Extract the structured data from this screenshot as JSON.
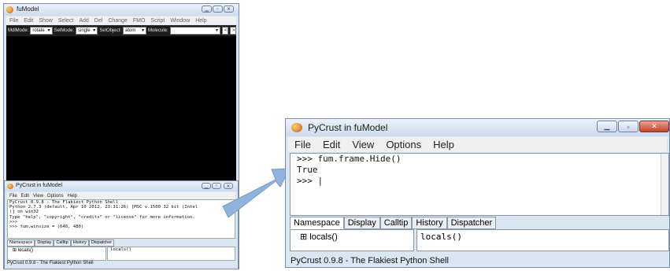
{
  "fumodel": {
    "title": "fuModel",
    "menu": [
      "File",
      "Edit",
      "Show",
      "Select",
      "Add",
      "Del",
      "Change",
      "FMO",
      "Script",
      "Window",
      "Help"
    ],
    "toolbar": {
      "mdl_mode_label": "MdlMode:",
      "mdl_mode_value": "rotate",
      "sel_mode_label": "SelMode:",
      "sel_mode_value": "single",
      "sel_object_label": "SelObject:",
      "sel_object_value": "atom",
      "molecule_label": "Molecule:",
      "molecule_value": ""
    }
  },
  "small_shell": {
    "title": "PyCrust in fuModel",
    "menu": [
      "File",
      "Edit",
      "View",
      "Options",
      "Help"
    ],
    "lines": [
      "PyCrust 0.9.8 - The Flakiest Python Shell",
      "Python 2.7.3 (default, Apr 10 2012, 23:31:26) [MSC v.1500 32 bit (Intel",
      ")] on win32",
      "Type \"help\", \"copyright\", \"credits\" or \"license\" for more information.",
      ">>>",
      ">>> fum.winsize = (640, 480)"
    ],
    "tabs": [
      "Namespace",
      "Display",
      "Calltip",
      "History",
      "Dispatcher"
    ],
    "tree_item": "locals()",
    "detail": "locals()",
    "status": "PyCrust 0.9.8 - The Flakiest Python Shell"
  },
  "big_shell": {
    "title": "PyCrust in fuModel",
    "menu": [
      "File",
      "Edit",
      "View",
      "Options",
      "Help"
    ],
    "lines": [
      ">>> fum.frame.Hide()",
      "True",
      ">>> |"
    ],
    "tabs": [
      "Namespace",
      "Display",
      "Calltip",
      "History",
      "Dispatcher"
    ],
    "tree_item": "locals()",
    "detail": "locals()",
    "status": "PyCrust 0.9.8 - The Flakiest Python Shell"
  },
  "colors": {
    "window_bg": "#dbe6f3",
    "canvas_bg": "#000000",
    "arrow": "#8fb3dc"
  }
}
